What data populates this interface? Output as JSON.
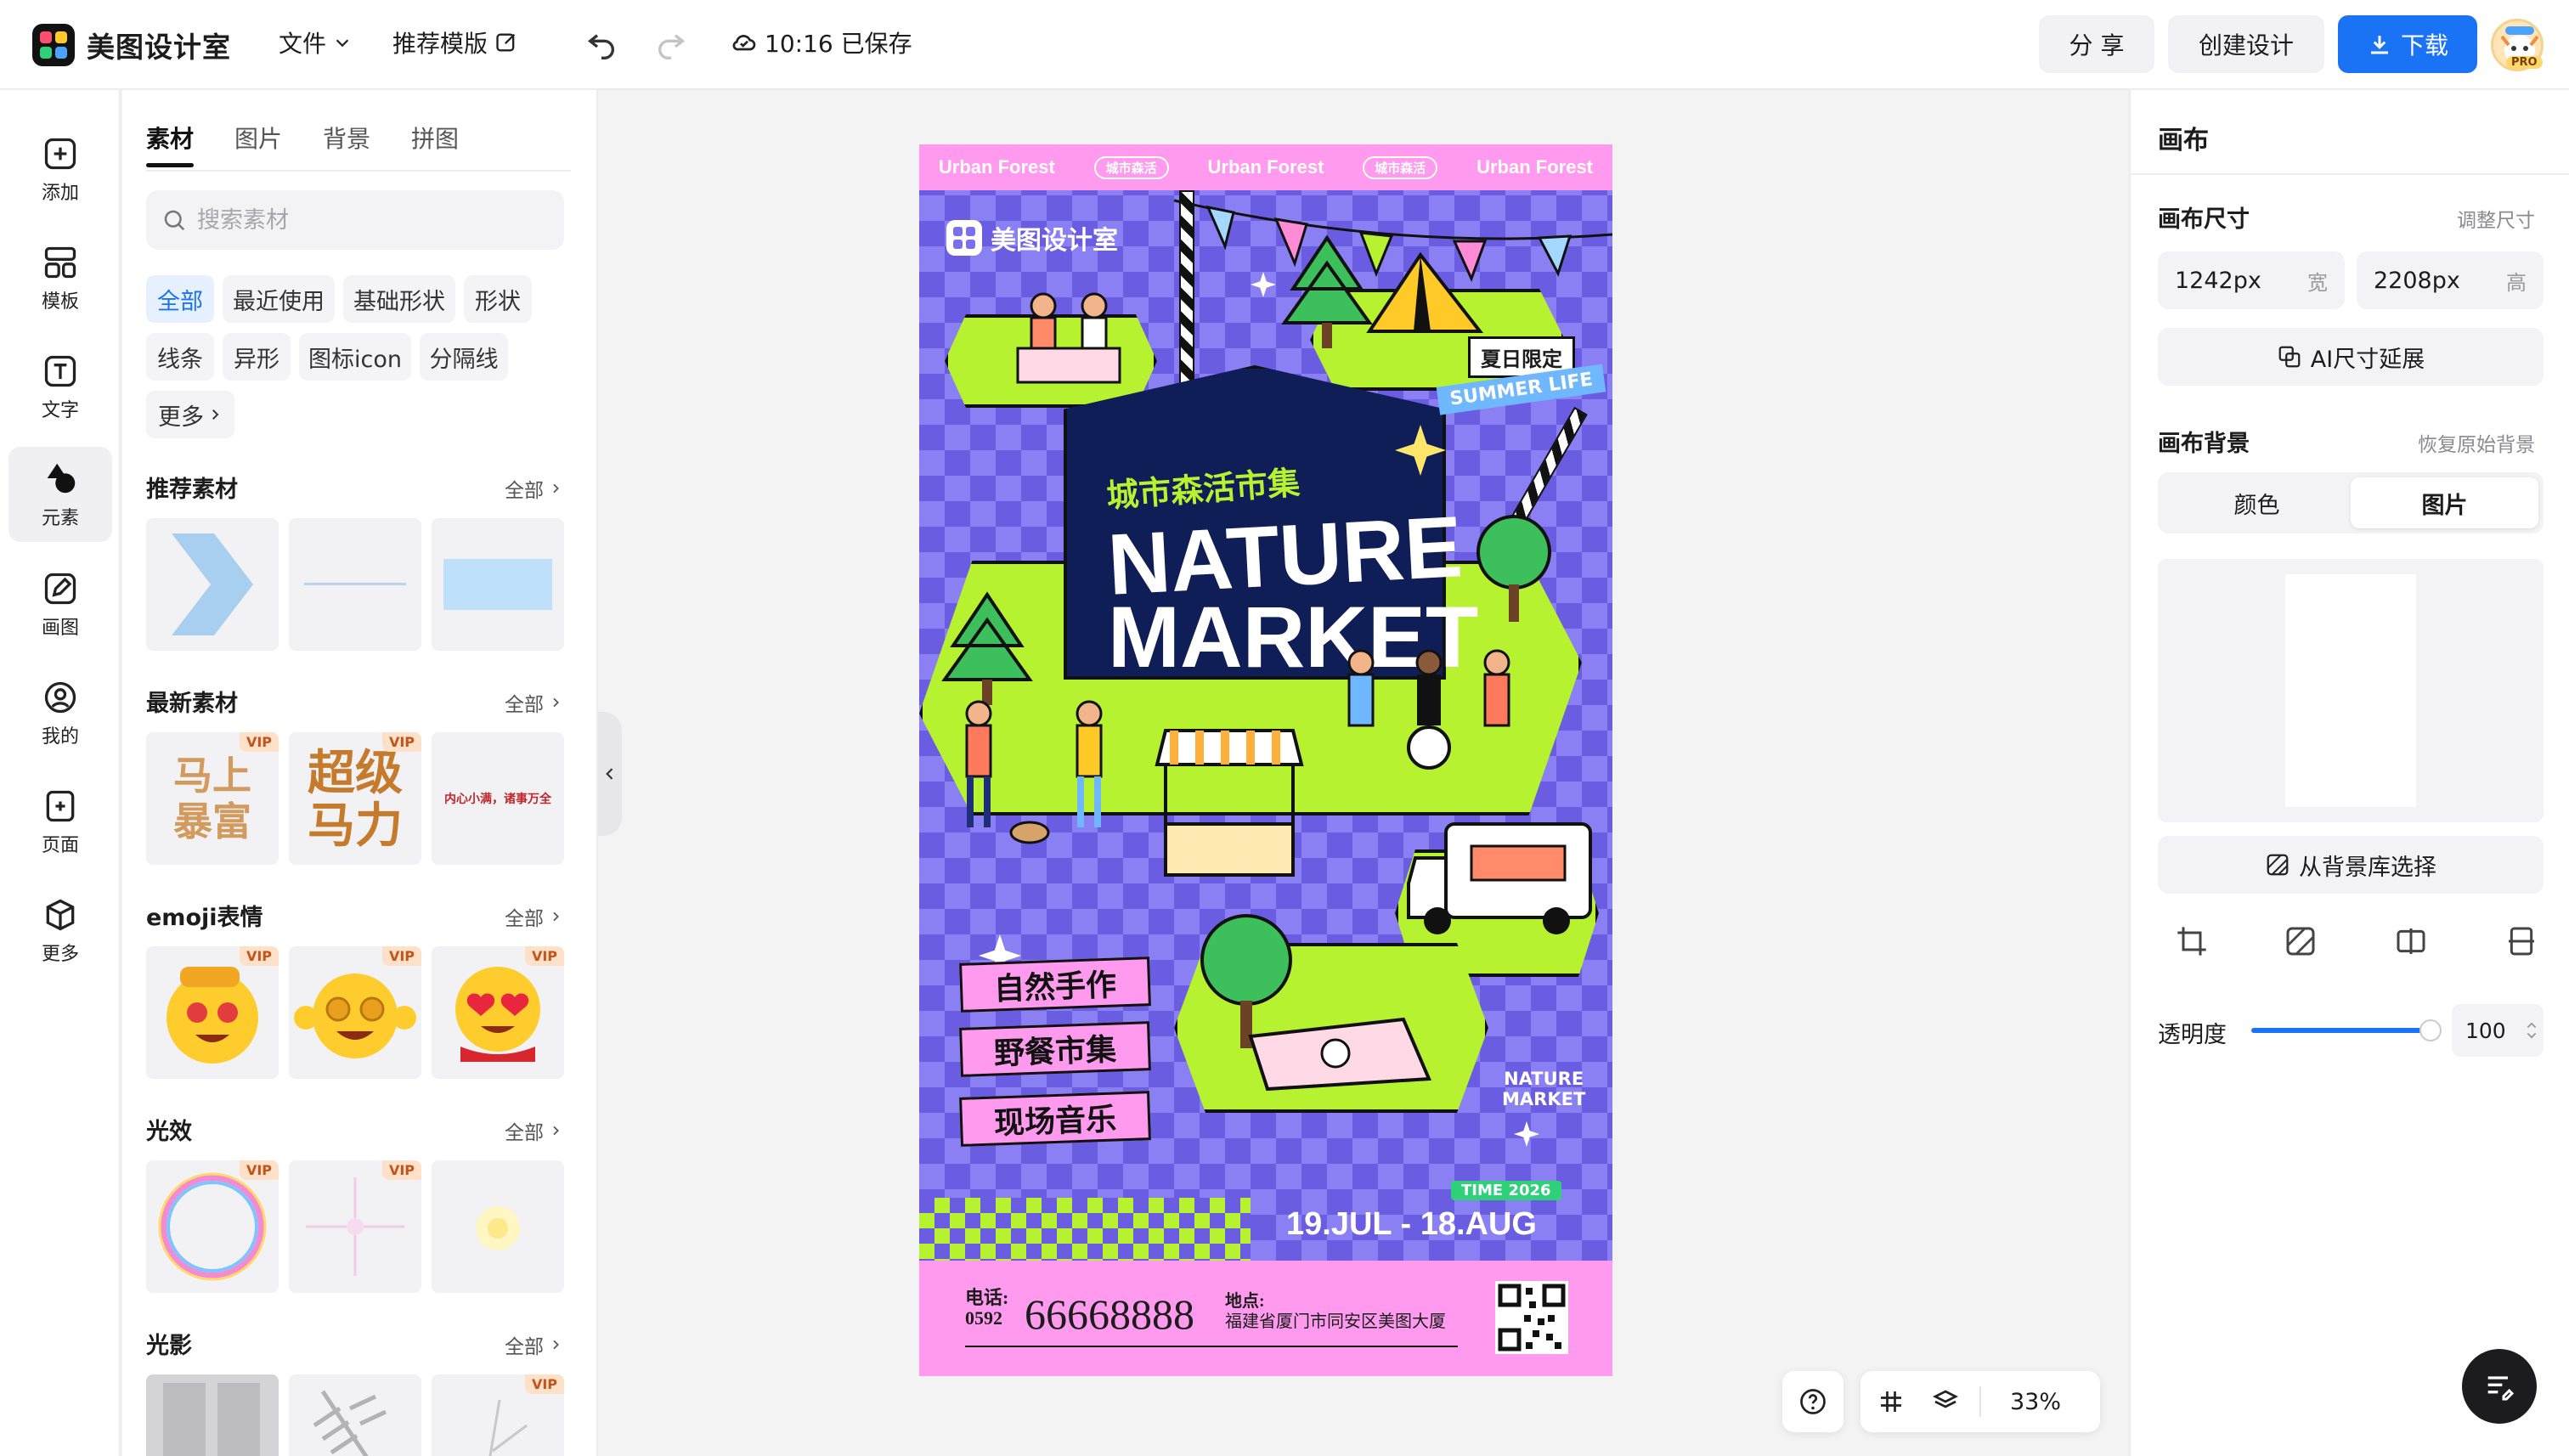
{
  "app": {
    "name": "美图设计室"
  },
  "header": {
    "file_menu": "文件",
    "recommend_template": "推荐模版",
    "save_status": "10:16 已保存",
    "share_label": "分 享",
    "create_label": "创建设计",
    "download_label": "下载",
    "pro_badge": "PRO"
  },
  "rail": [
    {
      "label": "添加",
      "icon": "plus-square-icon"
    },
    {
      "label": "模板",
      "icon": "template-grid-icon"
    },
    {
      "label": "文字",
      "icon": "text-t-icon"
    },
    {
      "label": "元素",
      "icon": "shapes-icon",
      "active": true
    },
    {
      "label": "画图",
      "icon": "pencil-icon"
    },
    {
      "label": "我的",
      "icon": "user-icon"
    },
    {
      "label": "页面",
      "icon": "page-add-icon"
    },
    {
      "label": "更多",
      "icon": "cube-icon"
    }
  ],
  "panel": {
    "tabs": [
      "素材",
      "图片",
      "背景",
      "拼图"
    ],
    "search_placeholder": "搜索素材",
    "chips": [
      "全部",
      "最近使用",
      "基础形状",
      "形状",
      "线条",
      "异形",
      "图标icon",
      "分隔线",
      "更多"
    ],
    "all_label": "全部",
    "vip_label": "VIP",
    "sections": [
      {
        "title": "推荐素材"
      },
      {
        "title": "最新素材",
        "texts": [
          "马上暴富",
          "超级马力",
          "内心小满，诸事万全"
        ]
      },
      {
        "title": "emoji表情"
      },
      {
        "title": "光效"
      },
      {
        "title": "光影"
      }
    ]
  },
  "poster": {
    "strip_text": "Urban Forest",
    "strip_pill": "城市森活",
    "brand": "美图设计室",
    "summer_tag": "夏日限定",
    "summer_life": "SUMMER LIFE",
    "subtitle_cn": "城市森活市集",
    "title_line1": "NATURE",
    "title_line2": "MARKET",
    "tags": [
      "自然手作",
      "野餐市集",
      "现场音乐"
    ],
    "small_logo_line1": "NATURE",
    "small_logo_line2": "MARKET",
    "time_badge": "TIME 2026",
    "dates": "19.JUL - 18.AUG",
    "phone_label": "电话:",
    "phone_area": "0592",
    "phone_number": "66668888",
    "address_label": "地点:",
    "address": "福建省厦门市同安区美图大厦"
  },
  "canvas_toolbar": {
    "zoom": "33%"
  },
  "right": {
    "title": "画布",
    "size_label": "画布尺寸",
    "adjust_size": "调整尺寸",
    "width_value": "1242px",
    "width_unit": "宽",
    "height_value": "2208px",
    "height_unit": "高",
    "ai_extend": "AI尺寸延展",
    "bg_label": "画布背景",
    "restore_bg": "恢复原始背景",
    "seg_color": "颜色",
    "seg_image": "图片",
    "from_library": "从背景库选择",
    "opacity_label": "透明度",
    "opacity_value": "100"
  },
  "colors": {
    "accent": "#1a73f5",
    "poster_purple": "#7b6ff0",
    "poster_pink": "#ff9aef",
    "poster_lime": "#b6f22f",
    "poster_navy": "#0f1e57"
  }
}
